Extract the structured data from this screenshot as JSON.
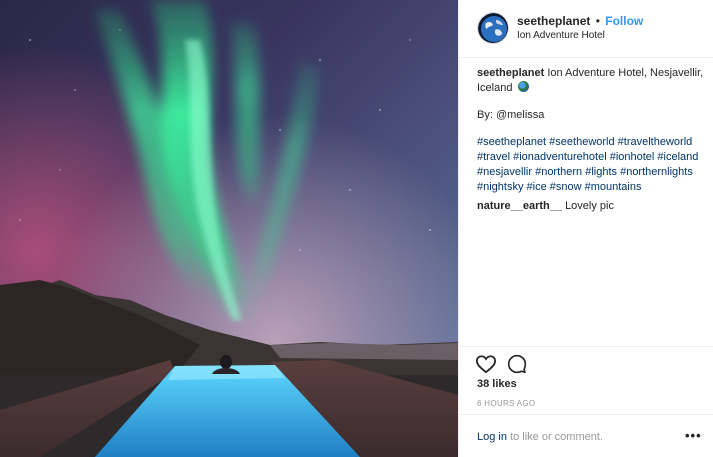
{
  "post": {
    "image_alt_icon": "aurora-photo",
    "username": "seetheplanet",
    "follow_separator": "•",
    "follow_label": "Follow",
    "location": "Ion Adventure Hotel",
    "caption_user": "seetheplanet",
    "caption_text": "Ion Adventure Hotel, Nesjavellir, Iceland",
    "caption_emoji_icon": "globe-icon",
    "credit": "By: @melissa",
    "hashtags": "#seetheplanet #seetheworld #traveltheworld #travel #ionadventurehotel #ionhotel #iceland #nesjavellir #northern #lights #northernlights #nightsky #ice #snow #mountains",
    "comment_user": "nature__earth__",
    "comment_text": "Lovely pic",
    "likes": "38 likes",
    "timestamp": "6 HOURS AGO",
    "login_link": "Log in",
    "login_rest": " to like or comment.",
    "more_label": "•••"
  },
  "colors": {
    "accent": "#3897f0",
    "link": "#003569",
    "muted": "#999999",
    "border": "#efefef"
  }
}
